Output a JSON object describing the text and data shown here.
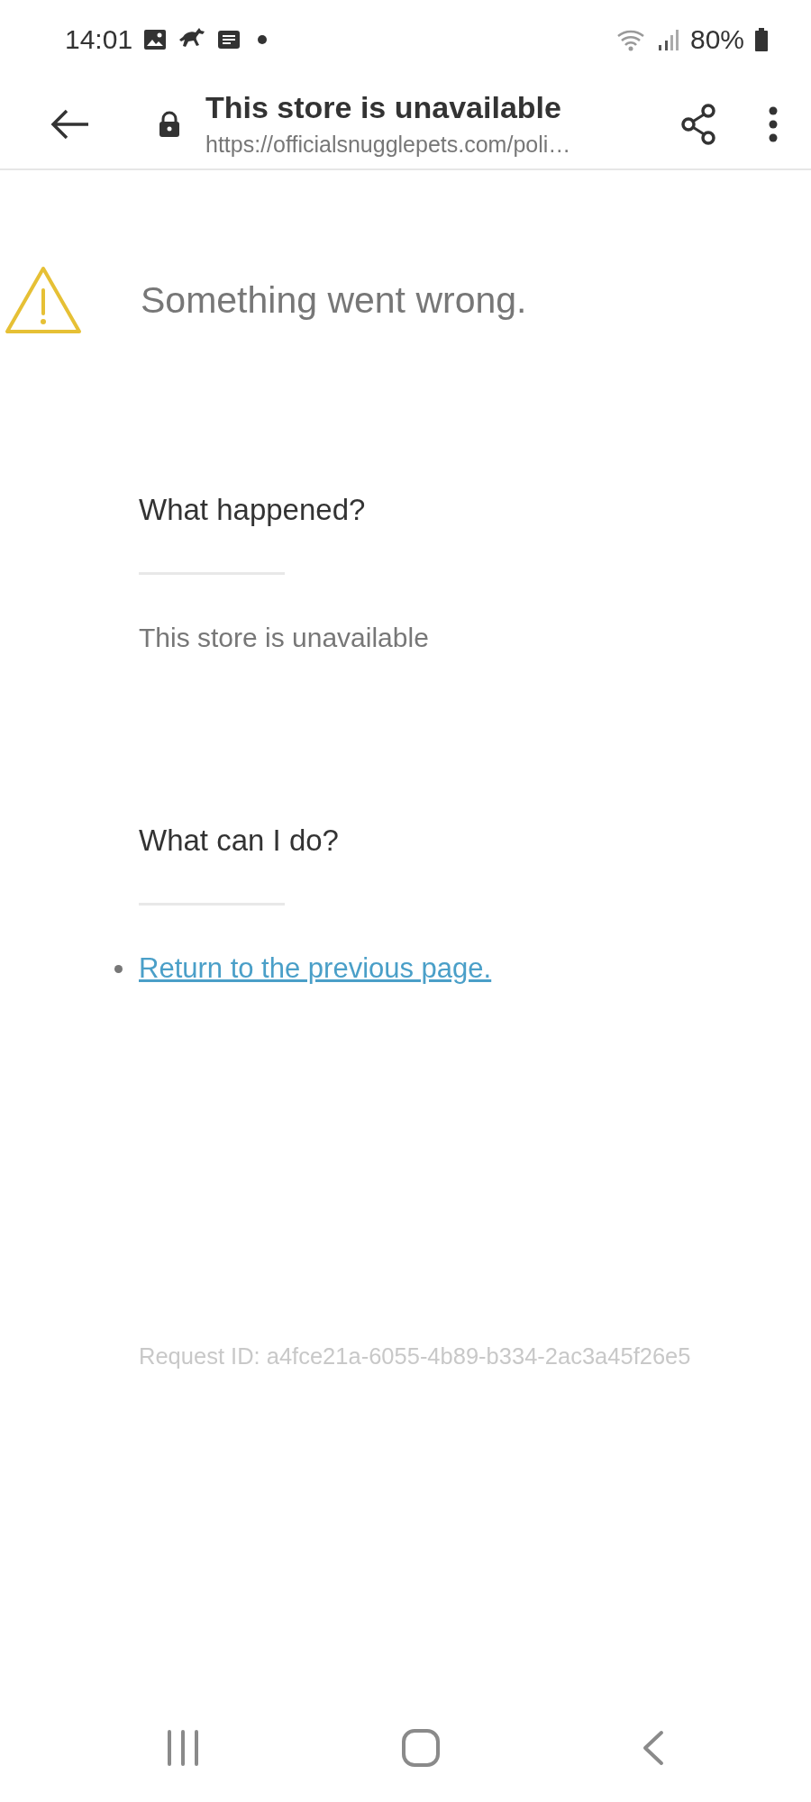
{
  "status_bar": {
    "time": "14:01",
    "battery": "80%"
  },
  "header": {
    "title": "This store is unavailable",
    "url": "https://officialsnugglepets.com/poli…"
  },
  "error": {
    "heading": "Something went wrong.",
    "sections": [
      {
        "kind": "text",
        "title": "What happened?",
        "text": "This store is unavailable"
      },
      {
        "kind": "links",
        "title": "What can I do?",
        "items": [
          "Return to the previous page."
        ]
      }
    ],
    "request_id": "Request ID: a4fce21a-6055-4b89-b334-2ac3a45f26e5"
  }
}
